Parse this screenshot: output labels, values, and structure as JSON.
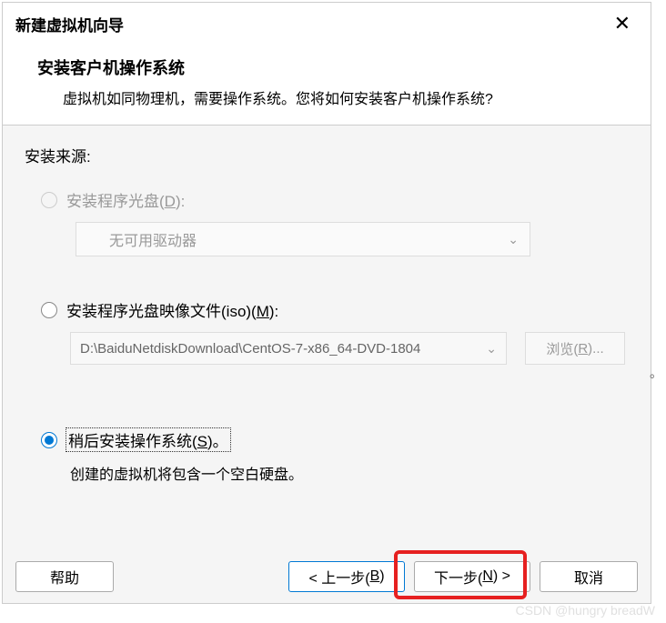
{
  "dialog": {
    "title": "新建虚拟机向导",
    "close": "✕"
  },
  "header": {
    "title": "安装客户机操作系统",
    "desc": "虚拟机如同物理机，需要操作系统。您将如何安装客户机操作系统?"
  },
  "source": {
    "label": "安装来源:",
    "disc": {
      "label": "安装程序光盘(D):",
      "dropdown": "无可用驱动器"
    },
    "iso": {
      "label": "安装程序光盘映像文件(iso)(M):",
      "path": "D:\\BaiduNetdiskDownload\\CentOS-7-x86_64-DVD-1804",
      "browse": "浏览(R)..."
    },
    "later": {
      "label": "稍后安装操作系统(S)。",
      "hint": "创建的虚拟机将包含一个空白硬盘。"
    }
  },
  "footer": {
    "help": "帮助",
    "prev": "< 上一步(B)",
    "next": "下一步(N) >",
    "cancel": "取消"
  },
  "watermark": "CSDN @hungry breadW"
}
